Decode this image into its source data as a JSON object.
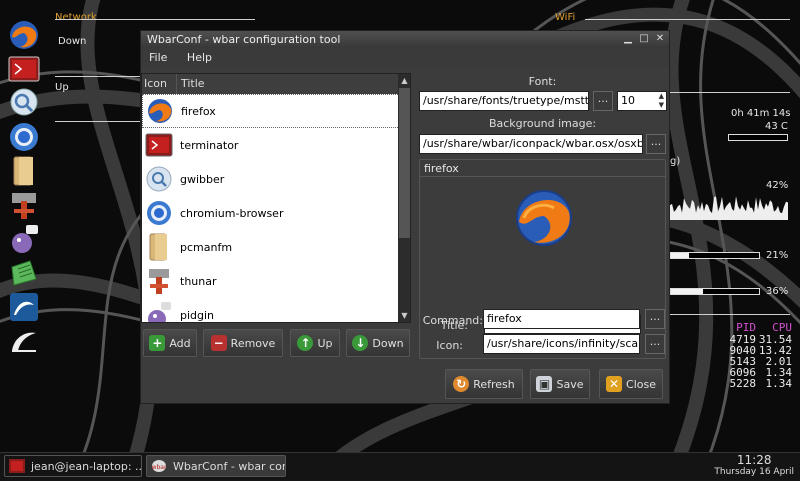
{
  "conky": {
    "network_label": "Network",
    "wifi_label": "WiFi",
    "down_label": "Down",
    "up_label": "Up",
    "uptime": "0h 41m 14s",
    "temp": "43 C",
    "cpu_percent_text": "42%",
    "cpu_paren": "g)",
    "mem_percent_text": "21%",
    "mem_fraction": 0.21,
    "swap_percent_text": "36%",
    "swap_fraction": 0.36,
    "proc_headers": [
      "PID",
      "CPU"
    ],
    "processes": [
      [
        "4719",
        "31.54"
      ],
      [
        "9040",
        "13.42"
      ],
      [
        "5143",
        "2.01"
      ],
      [
        "6096",
        "1.34"
      ],
      [
        "5228",
        "1.34"
      ]
    ]
  },
  "dock": {
    "icons": [
      "firefox-icon",
      "terminator-icon",
      "gwibber-icon",
      "chromium-icon",
      "pcmanfm-icon",
      "thunar-icon",
      "pidgin-icon",
      "text-editor-icon",
      "wireshark-icon",
      "shell-icon"
    ]
  },
  "window": {
    "title": "WbarConf - wbar configuration tool",
    "menu": [
      "File",
      "Help"
    ],
    "list_headers": [
      "Icon",
      "Title"
    ],
    "items": [
      {
        "title": "firefox",
        "icon": "firefox-icon"
      },
      {
        "title": "terminator",
        "icon": "terminator-icon"
      },
      {
        "title": "gwibber",
        "icon": "gwibber-icon"
      },
      {
        "title": "chromium-browser",
        "icon": "chromium-icon"
      },
      {
        "title": "pcmanfm",
        "icon": "pcmanfm-icon"
      },
      {
        "title": "thunar",
        "icon": "thunar-icon"
      },
      {
        "title": "pidgin",
        "icon": "pidgin-icon"
      }
    ],
    "buttons": {
      "add": "Add",
      "remove": "Remove",
      "up": "Up",
      "down": "Down",
      "refresh": "Refresh",
      "save": "Save",
      "close": "Close"
    },
    "font_label": "Font:",
    "font_path": "/usr/share/fonts/truetype/msttcorefonts",
    "font_size": "10",
    "bg_label": "Background image:",
    "bg_path": "/usr/share/wbar/iconpack/wbar.osx/osxbarback.png",
    "browse": "...",
    "group_title": "firefox",
    "title_label": "Title:",
    "title_value": "firefox",
    "command_label": "Command:",
    "command_value": "firefox",
    "icon_label": "Icon:",
    "icon_value": "/usr/share/icons/infinity/scalable/apps/firefox.png"
  },
  "taskbar": {
    "tasks": [
      "jean@jean-laptop: ...",
      "WbarConf - wbar con..."
    ],
    "time": "11:28",
    "date": "Thursday 16 April"
  },
  "colors": {
    "conky_heading": "#e0a030",
    "proc_header": "#d050d0",
    "window_bg": "#3c3c3c"
  }
}
